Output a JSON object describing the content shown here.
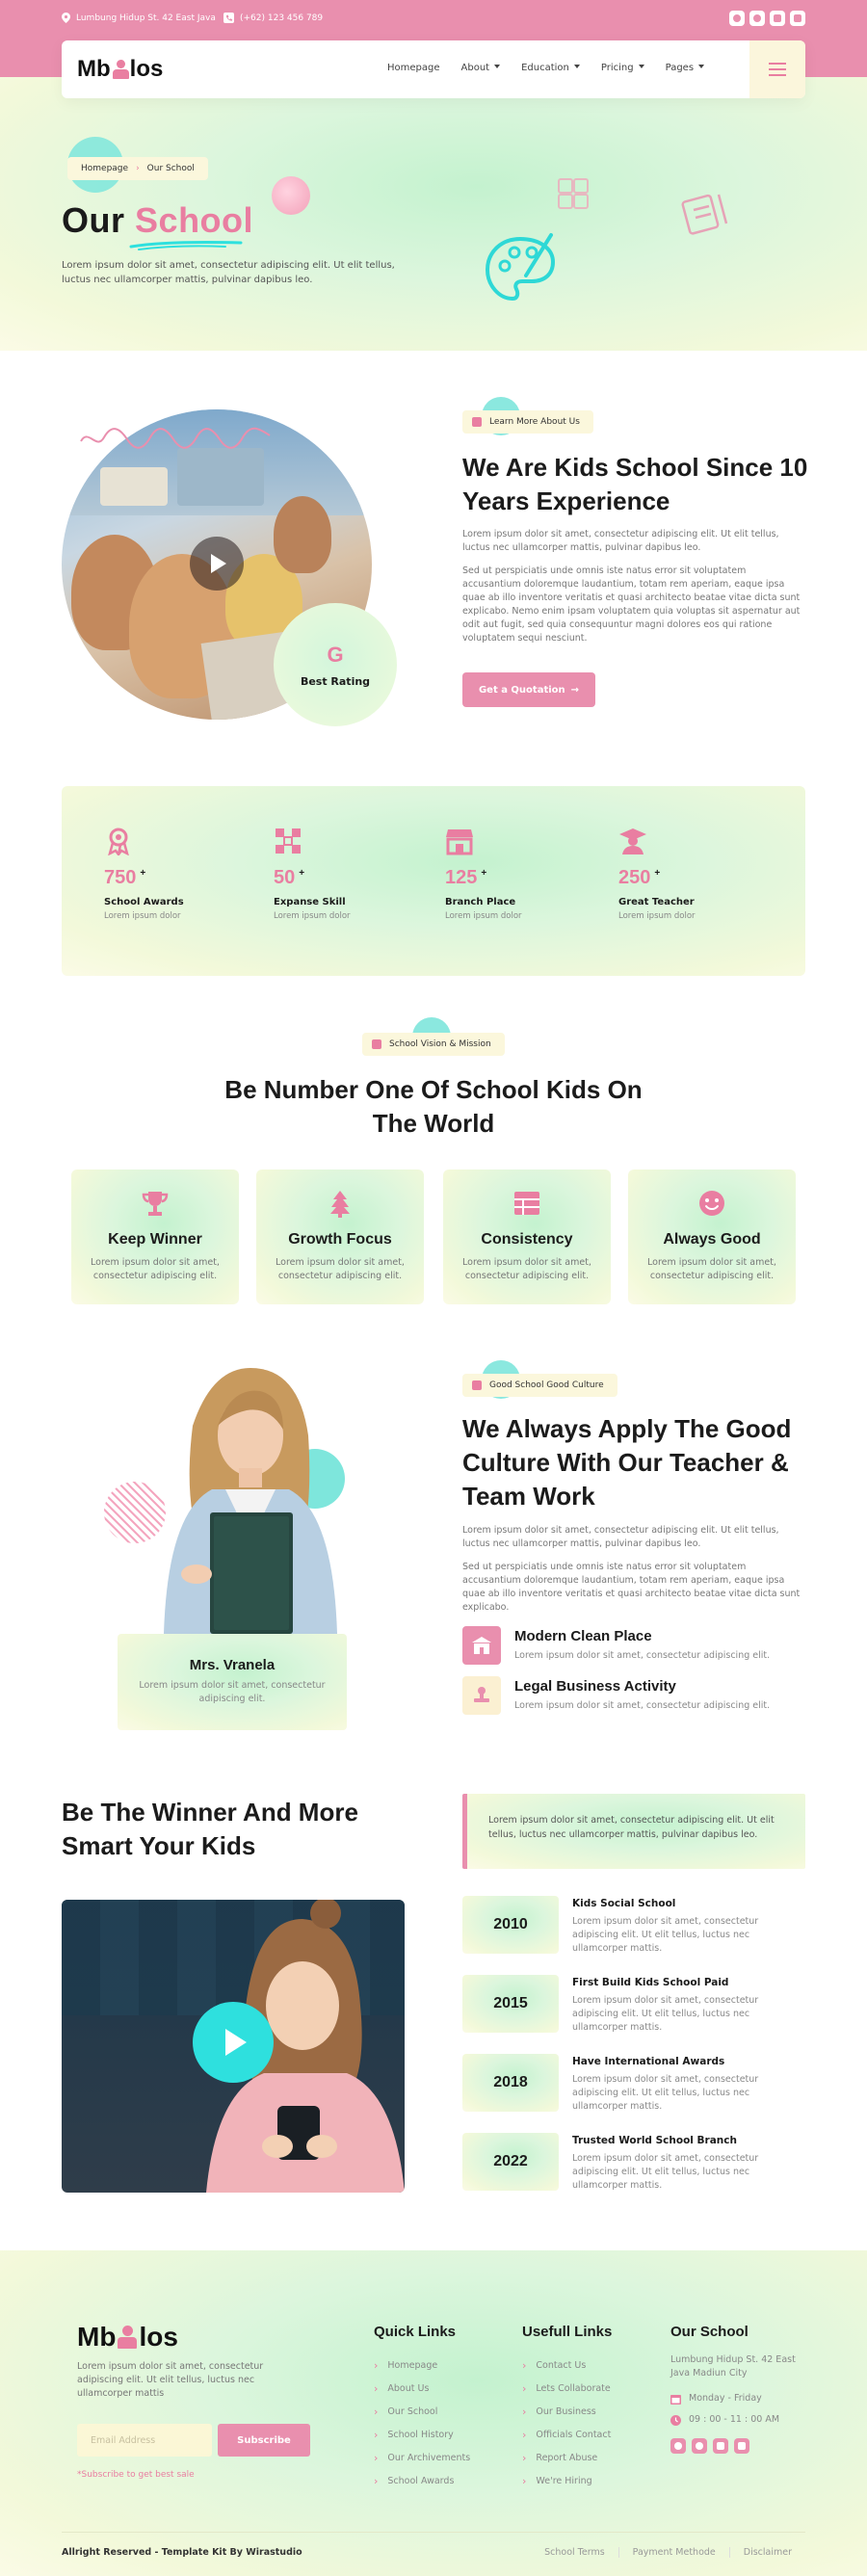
{
  "topbar": {
    "address": "Lumbung Hidup St. 42 East Java",
    "phone": "(+62) 123 456 789",
    "social_icons": [
      "facebook-icon",
      "twitter-icon",
      "youtube-icon",
      "instagram-icon"
    ]
  },
  "navbar": {
    "logo_left": "Mb",
    "logo_right": "los",
    "items": [
      {
        "label": "Homepage",
        "dropdown": false
      },
      {
        "label": "About",
        "dropdown": true
      },
      {
        "label": "Education",
        "dropdown": true
      },
      {
        "label": "Pricing",
        "dropdown": true
      },
      {
        "label": "Pages",
        "dropdown": true
      }
    ]
  },
  "hero": {
    "breadcrumb": [
      "Homepage",
      "Our School"
    ],
    "title_plain": "Our",
    "title_accent": "School",
    "description": "Lorem ipsum dolor sit amet, consectetur adipiscing elit. Ut elit tellus, luctus nec ullamcorper mattis, pulvinar dapibus leo."
  },
  "about": {
    "tag": "Learn More About Us",
    "title": "We Are Kids School Since 10 Years Experience",
    "para1": "Lorem ipsum dolor sit amet, consectetur adipiscing elit. Ut elit tellus, luctus nec ullamcorper mattis, pulvinar dapibus leo.",
    "para2": "Sed ut perspiciatis unde omnis iste natus error sit voluptatem accusantium doloremque laudantium, totam rem aperiam, eaque ipsa quae ab illo inventore veritatis et quasi architecto beatae vitae dicta sunt explicabo. Nemo enim ipsam voluptatem quia voluptas sit aspernatur aut odit aut fugit, sed quia consequuntur magni dolores eos qui ratione voluptatem sequi nesciunt.",
    "button": "Get a Quotation",
    "rating_letter": "G",
    "rating_label": "Best Rating"
  },
  "stats": [
    {
      "icon": "medal-icon",
      "value": "750",
      "label": "School Awards",
      "sub": "Lorem ipsum dolor"
    },
    {
      "icon": "network-icon",
      "value": "50",
      "label": "Expanse Skill",
      "sub": "Lorem ipsum dolor"
    },
    {
      "icon": "store-icon",
      "value": "125",
      "label": "Branch Place",
      "sub": "Lorem ipsum dolor"
    },
    {
      "icon": "graduate-icon",
      "value": "250",
      "label": "Great Teacher",
      "sub": "Lorem ipsum dolor"
    }
  ],
  "stats_suffix": "+",
  "vision": {
    "tag": "School Vision & Mission",
    "title_line1": "Be Number One Of School Kids On",
    "title_line2": "The World",
    "cards": [
      {
        "icon": "trophy-icon",
        "title": "Keep Winner",
        "desc": "Lorem ipsum dolor sit amet, consectetur adipiscing elit."
      },
      {
        "icon": "tree-icon",
        "title": "Growth Focus",
        "desc": "Lorem ipsum dolor sit amet, consectetur adipiscing elit."
      },
      {
        "icon": "table-icon",
        "title": "Consistency",
        "desc": "Lorem ipsum dolor sit amet, consectetur adipiscing elit."
      },
      {
        "icon": "smile-icon",
        "title": "Always Good",
        "desc": "Lorem ipsum dolor sit amet, consectetur adipiscing elit."
      }
    ]
  },
  "culture": {
    "tag": "Good School Good Culture",
    "title_line1": "We Always Apply The Good",
    "title_line2": "Culture With Our Teacher &",
    "title_line3": "Team Work",
    "para1": "Lorem ipsum dolor sit amet, consectetur adipiscing elit. Ut elit tellus, luctus nec ullamcorper mattis, pulvinar dapibus leo.",
    "para2": "Sed ut perspiciatis unde omnis iste natus error sit voluptatem accusantium doloremque laudantium, totam rem aperiam, eaque ipsa quae ab illo inventore veritatis et quasi architecto beatae vitae dicta sunt explicabo.",
    "teacher_name": "Mrs. Vranela",
    "teacher_desc": "Lorem ipsum dolor sit amet, consectetur adipiscing elit.",
    "features": [
      {
        "icon": "school-icon",
        "title": "Modern Clean Place",
        "desc": "Lorem ipsum dolor sit amet, consectetur adipiscing elit."
      },
      {
        "icon": "stamp-icon",
        "title": "Legal Business Activity",
        "desc": "Lorem ipsum dolor sit amet, consectetur adipiscing elit."
      }
    ]
  },
  "winner": {
    "title_line1": "Be The Winner And More",
    "title_line2": "Smart Your Kids",
    "quote": "Lorem ipsum dolor sit amet, consectetur adipiscing elit. Ut elit tellus, luctus nec ullamcorper mattis, pulvinar dapibus leo.",
    "timeline": [
      {
        "year": "2010",
        "title": "Kids Social School",
        "desc": "Lorem ipsum dolor sit amet, consectetur adipiscing elit. Ut elit tellus, luctus nec ullamcorper mattis."
      },
      {
        "year": "2015",
        "title": "First Build Kids School Paid",
        "desc": "Lorem ipsum dolor sit amet, consectetur adipiscing elit. Ut elit tellus, luctus nec ullamcorper mattis."
      },
      {
        "year": "2018",
        "title": "Have International Awards",
        "desc": "Lorem ipsum dolor sit amet, consectetur adipiscing elit. Ut elit tellus, luctus nec ullamcorper mattis."
      },
      {
        "year": "2022",
        "title": "Trusted World School Branch",
        "desc": "Lorem ipsum dolor sit amet, consectetur adipiscing elit. Ut elit tellus, luctus nec ullamcorper mattis."
      }
    ]
  },
  "footer": {
    "logo_left": "Mb",
    "logo_right": "los",
    "desc": "Lorem ipsum dolor sit amet, consectetur adipiscing elit. Ut elit tellus, luctus nec ullamcorper mattis",
    "email_placeholder": "Email Address",
    "subscribe": "Subscribe",
    "subscribe_note": "*Subscribe to get best sale",
    "quick_links_title": "Quick Links",
    "quick_links": [
      "Homepage",
      "About Us",
      "Our School",
      "School History",
      "Our Archivements",
      "School Awards"
    ],
    "useful_links_title": "Usefull Links",
    "useful_links": [
      "Contact Us",
      "Lets Collaborate",
      "Our Business",
      "Officials Contact",
      "Report Abuse",
      "We're Hiring"
    ],
    "school_title": "Our School",
    "school_address": "Lumbung Hidup St. 42 East Java Madiun City",
    "school_days": "Monday - Friday",
    "school_hours": "09 : 00 - 11 : 00 AM",
    "copyright": "Allright Reserved - Template Kit By Wirastudio",
    "legal": [
      "School Terms",
      "Payment Methode",
      "Disclaimer"
    ]
  },
  "colors": {
    "accent": "#e98fae",
    "teal": "#2ee0de",
    "mint": "#c8f3d1",
    "cream": "#fbf7dc"
  }
}
